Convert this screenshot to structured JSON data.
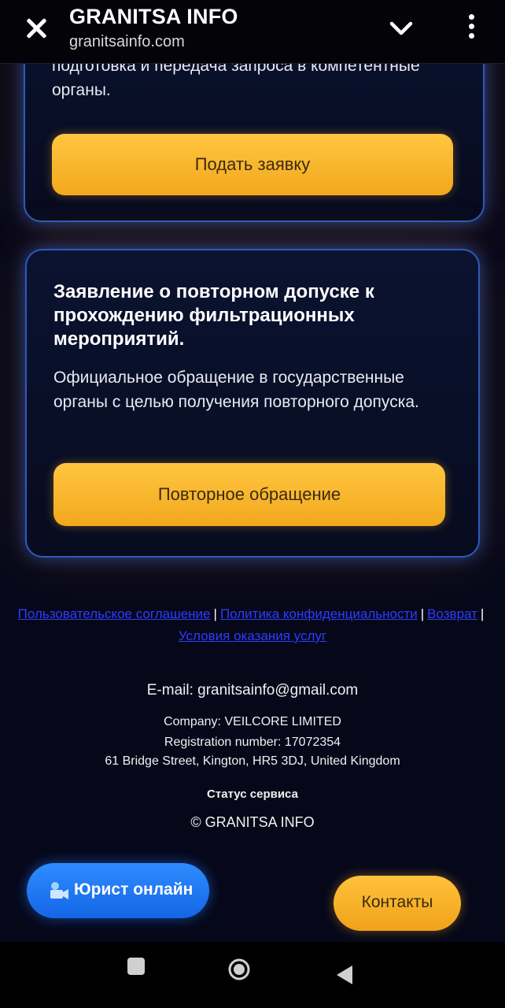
{
  "header": {
    "title": "GRANITSA INFO",
    "url": "granitsainfo.com"
  },
  "card1": {
    "text": "подготовка и передача запроса в компетентные органы.",
    "button": "Подать заявку"
  },
  "card2": {
    "title": "Заявление о повторном допуске к прохождению фильтрационных мероприятий.",
    "text": "Официальное обращение в государственные органы с целью получения повторного допуска.",
    "button": "Повторное обращение"
  },
  "footer_links": {
    "user_agreement": "Пользовательское соглашение",
    "privacy": "Политика конфиденциальности",
    "refund": "Возврат",
    "terms": "Условия оказания услуг",
    "separator": "|"
  },
  "footer": {
    "email": "E-mail: granitsainfo@gmail.com",
    "company": "Company: VEILCORE LIMITED",
    "registration": "Registration number: 17072354",
    "address": "61 Bridge Street, Kington, HR5 3DJ, United Kingdom",
    "status": "Статус сервиса",
    "copyright": "© GRANITSA INFO"
  },
  "floating": {
    "lawyer_button": "Юрист онлайн",
    "contacts_button": "Контакты"
  },
  "colors": {
    "accent_yellow": "#f2a81c",
    "accent_blue": "#1466e6",
    "link_blue": "#2e3cff",
    "background": "#06081a"
  }
}
